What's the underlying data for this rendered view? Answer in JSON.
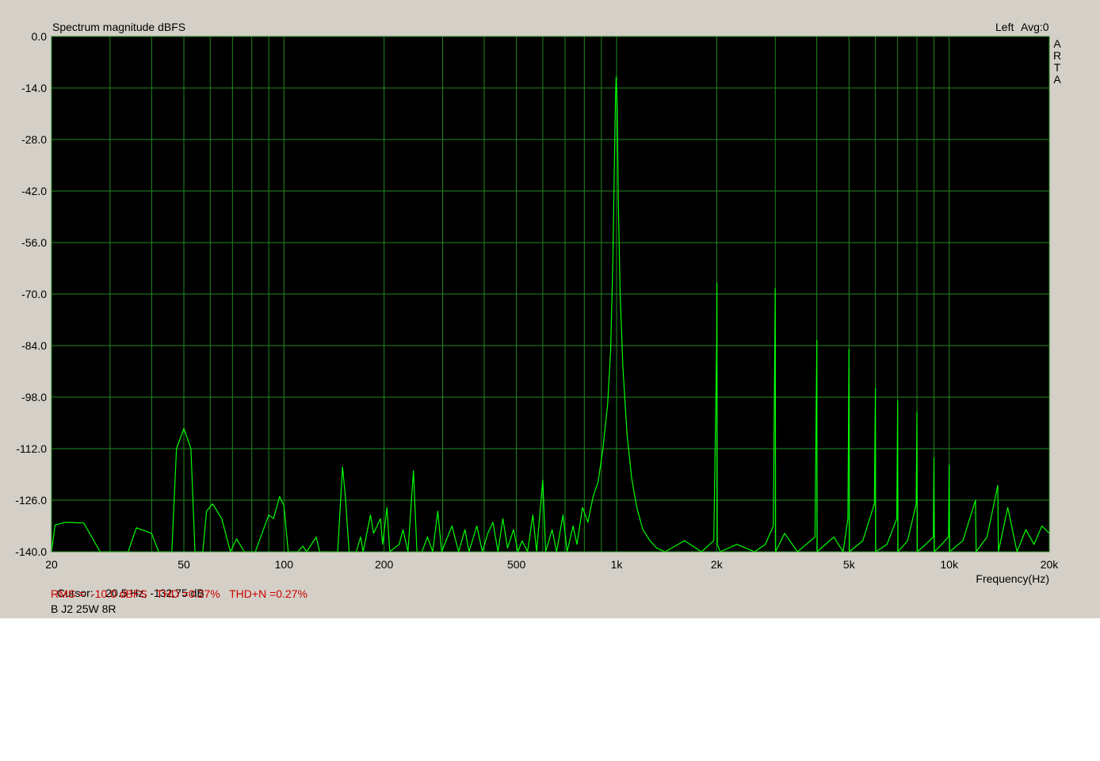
{
  "chart_data": {
    "type": "line",
    "title": "Spectrum magnitude dBFS",
    "channel_label": "Left",
    "avg_label": "Avg:0",
    "brand": "ARTA",
    "xlabel": "Frequency(Hz)",
    "ylabel": "",
    "x_scale": "log",
    "xlim": [
      20,
      20000
    ],
    "ylim": [
      -140,
      0
    ],
    "grid": true,
    "y_ticks": [
      0,
      -14,
      -28,
      -42,
      -56,
      -70,
      -84,
      -98,
      -112,
      -126,
      -140
    ],
    "y_tick_labels": [
      "0.0",
      "-14.0",
      "-28.0",
      "-42.0",
      "-56.0",
      "-70.0",
      "-84.0",
      "-98.0",
      "-112.0",
      "-126.0",
      "-140.0"
    ],
    "x_ticks": [
      20,
      100,
      200,
      500,
      1000,
      2000,
      5000,
      10000,
      20000
    ],
    "x_tick_labels": [
      "20",
      "50",
      "100",
      "200",
      "500",
      "1k",
      "2k",
      "5k",
      "10k",
      "20k"
    ],
    "x_tick_label_values": [
      20,
      50,
      100,
      200,
      500,
      1000,
      2000,
      5000,
      10000,
      20000
    ],
    "x_minor_grid": [
      30,
      40,
      50,
      60,
      70,
      80,
      90,
      300,
      400,
      600,
      700,
      800,
      900,
      3000,
      4000,
      6000,
      7000,
      8000,
      9000
    ],
    "colors": {
      "plot_background": "#000000",
      "grid": "#1f8a1f",
      "trace": "#00ff00",
      "panel": "#d4d0c8",
      "stats_text": "#cc0000"
    },
    "series": [
      {
        "name": "",
        "points": [
          [
            20,
            -140
          ],
          [
            20.5,
            -132.75
          ],
          [
            22,
            -132
          ],
          [
            25,
            -132.2
          ],
          [
            28,
            -140
          ],
          [
            30,
            -140
          ],
          [
            34,
            -140
          ],
          [
            36,
            -133.5
          ],
          [
            40,
            -135
          ],
          [
            42,
            -140
          ],
          [
            46,
            -140
          ],
          [
            47.5,
            -112
          ],
          [
            50,
            -106.5
          ],
          [
            52.5,
            -112
          ],
          [
            54,
            -140
          ],
          [
            57,
            -140
          ],
          [
            58.5,
            -129
          ],
          [
            61,
            -127
          ],
          [
            65,
            -131
          ],
          [
            69,
            -140
          ],
          [
            72,
            -136.5
          ],
          [
            76,
            -140
          ],
          [
            82,
            -140
          ],
          [
            90,
            -130
          ],
          [
            93,
            -131
          ],
          [
            97,
            -125
          ],
          [
            100,
            -127.5
          ],
          [
            103,
            -140
          ],
          [
            110,
            -140
          ],
          [
            114,
            -138.5
          ],
          [
            117,
            -140
          ],
          [
            125,
            -136
          ],
          [
            128,
            -140
          ],
          [
            145,
            -140
          ],
          [
            150,
            -117
          ],
          [
            153,
            -125
          ],
          [
            157,
            -140
          ],
          [
            165,
            -140
          ],
          [
            170,
            -136
          ],
          [
            173,
            -140
          ],
          [
            182,
            -130
          ],
          [
            186,
            -135
          ],
          [
            195,
            -131
          ],
          [
            198,
            -138
          ],
          [
            204,
            -128
          ],
          [
            208,
            -140
          ],
          [
            222,
            -138
          ],
          [
            228,
            -134
          ],
          [
            236,
            -140
          ],
          [
            245,
            -118
          ],
          [
            251,
            -140
          ],
          [
            260,
            -140
          ],
          [
            270,
            -136
          ],
          [
            280,
            -140
          ],
          [
            290,
            -129
          ],
          [
            298,
            -140
          ],
          [
            320,
            -133
          ],
          [
            335,
            -140
          ],
          [
            350,
            -134
          ],
          [
            360,
            -140
          ],
          [
            380,
            -133
          ],
          [
            395,
            -140
          ],
          [
            410,
            -135
          ],
          [
            425,
            -132
          ],
          [
            440,
            -140
          ],
          [
            455,
            -131
          ],
          [
            470,
            -139
          ],
          [
            490,
            -134
          ],
          [
            505,
            -140
          ],
          [
            520,
            -137
          ],
          [
            540,
            -140
          ],
          [
            560,
            -130
          ],
          [
            575,
            -140
          ],
          [
            600,
            -120.5
          ],
          [
            612,
            -140
          ],
          [
            640,
            -134
          ],
          [
            660,
            -140
          ],
          [
            690,
            -130
          ],
          [
            710,
            -140
          ],
          [
            740,
            -133
          ],
          [
            760,
            -138
          ],
          [
            790,
            -128
          ],
          [
            820,
            -132
          ],
          [
            850,
            -125
          ],
          [
            880,
            -121
          ],
          [
            910,
            -112
          ],
          [
            940,
            -100
          ],
          [
            960,
            -85
          ],
          [
            975,
            -60
          ],
          [
            985,
            -35
          ],
          [
            993,
            -16
          ],
          [
            997,
            -11
          ],
          [
            1000,
            -13
          ],
          [
            1005,
            -20
          ],
          [
            1012,
            -45
          ],
          [
            1025,
            -70
          ],
          [
            1045,
            -90
          ],
          [
            1075,
            -108
          ],
          [
            1110,
            -120
          ],
          [
            1150,
            -128
          ],
          [
            1200,
            -134
          ],
          [
            1260,
            -137
          ],
          [
            1320,
            -139
          ],
          [
            1400,
            -140
          ],
          [
            1600,
            -137
          ],
          [
            1800,
            -140
          ],
          [
            1960,
            -137
          ],
          [
            2000,
            -84
          ],
          [
            2003,
            -67
          ],
          [
            2008,
            -138
          ],
          [
            2050,
            -140
          ],
          [
            2300,
            -138
          ],
          [
            2600,
            -140
          ],
          [
            2800,
            -138
          ],
          [
            2960,
            -133
          ],
          [
            3000,
            -68.5
          ],
          [
            3008,
            -140
          ],
          [
            3200,
            -135
          ],
          [
            3500,
            -140
          ],
          [
            3950,
            -136
          ],
          [
            4000,
            -82.5
          ],
          [
            4010,
            -140
          ],
          [
            4500,
            -136
          ],
          [
            4800,
            -140
          ],
          [
            4960,
            -131
          ],
          [
            5000,
            -85
          ],
          [
            5012,
            -140
          ],
          [
            5500,
            -137
          ],
          [
            5960,
            -127
          ],
          [
            6000,
            -95.5
          ],
          [
            6015,
            -140
          ],
          [
            6500,
            -138
          ],
          [
            6960,
            -131
          ],
          [
            7000,
            -99
          ],
          [
            7018,
            -140
          ],
          [
            7500,
            -137
          ],
          [
            7960,
            -127
          ],
          [
            8000,
            -102
          ],
          [
            8020,
            -140
          ],
          [
            8500,
            -138
          ],
          [
            8960,
            -136
          ],
          [
            9000,
            -114.5
          ],
          [
            9025,
            -140
          ],
          [
            9500,
            -138
          ],
          [
            9960,
            -136
          ],
          [
            10000,
            -116.5
          ],
          [
            10030,
            -140
          ],
          [
            11000,
            -137
          ],
          [
            12000,
            -126
          ],
          [
            12050,
            -140
          ],
          [
            13000,
            -136
          ],
          [
            14000,
            -122
          ],
          [
            14060,
            -140
          ],
          [
            15000,
            -128
          ],
          [
            16000,
            -140
          ],
          [
            17000,
            -134
          ],
          [
            18000,
            -138
          ],
          [
            19000,
            -133
          ],
          [
            20000,
            -135
          ]
        ]
      }
    ]
  },
  "cursor": {
    "label": "Cursor:",
    "value": "20.5 Hz, -132.75 dB"
  },
  "stats_line": "RMS =  -10.0 dBFS   THD =0.27%   THD+N =0.27%",
  "measurement_name": "B J2 25W 8R"
}
